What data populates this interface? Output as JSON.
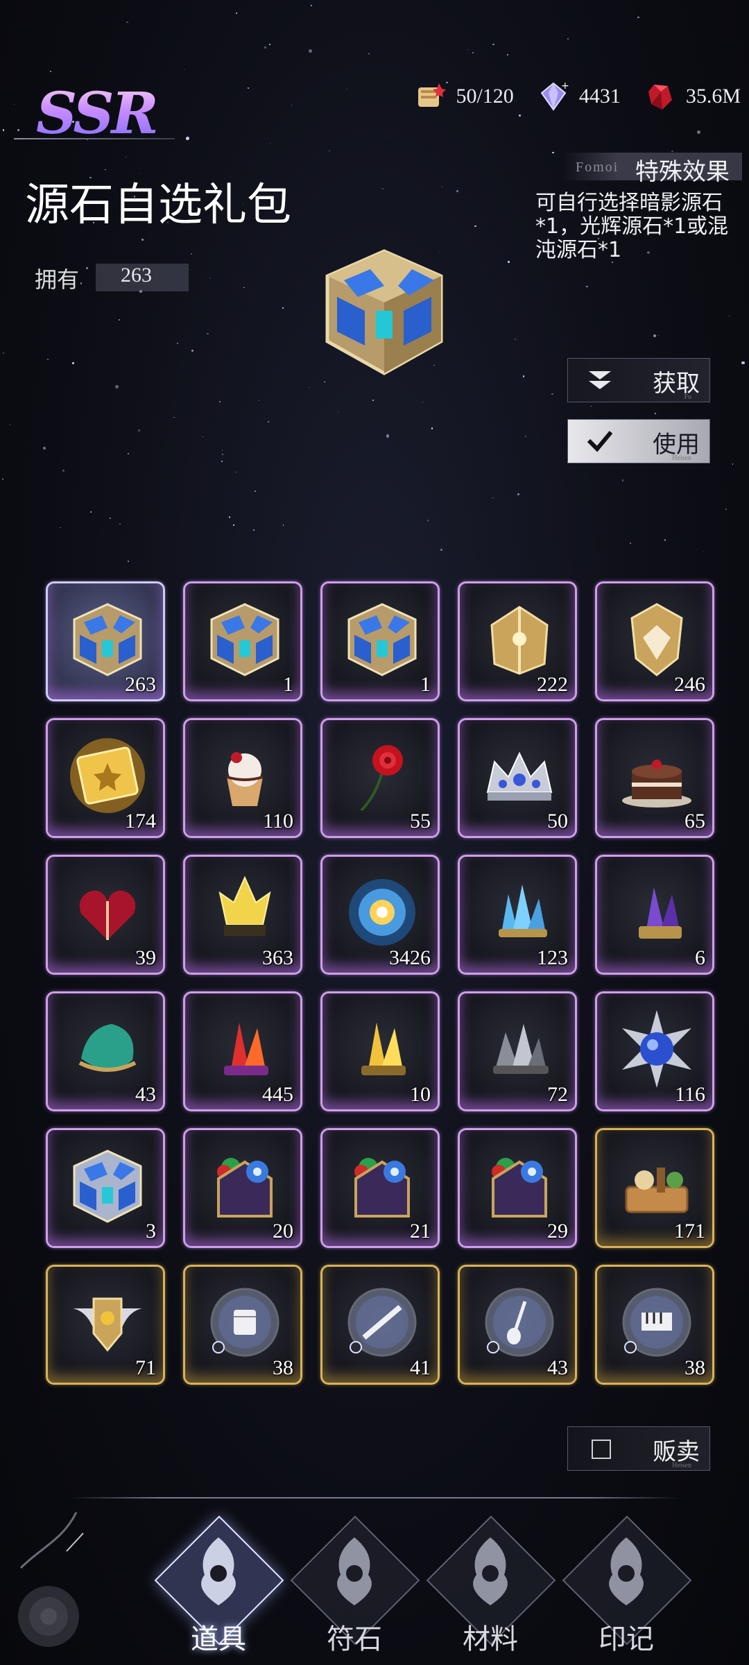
{
  "resources": [
    {
      "icon": "stamina-scroll-icon",
      "value": "50/120"
    },
    {
      "icon": "crystal-plus-icon",
      "value": "4431"
    },
    {
      "icon": "red-gem-icon",
      "value": "35.6M"
    }
  ],
  "rarity": "SSR",
  "item": {
    "name": "源石自选礼包",
    "owned_label": "拥有",
    "owned_value": "263"
  },
  "effect": {
    "subtitle": "Fomoi",
    "title": "特殊效果",
    "description": "可自行选择暗影源石*1，光辉源石*1或混沌源石*1"
  },
  "buttons": {
    "get": "获取",
    "get_sub": "Fo",
    "use": "使用",
    "use_sub": "Heisen",
    "sell": "贩卖",
    "sell_sub": "Heisen"
  },
  "inventory": [
    {
      "icon": "blue-chest-icon",
      "count": "263",
      "rarity": "ssr",
      "selected": true
    },
    {
      "icon": "blue-chest-icon",
      "count": "1",
      "rarity": "ssr"
    },
    {
      "icon": "blue-chest-icon",
      "count": "1",
      "rarity": "ssr"
    },
    {
      "icon": "gold-armor-icon",
      "count": "222",
      "rarity": "ssr"
    },
    {
      "icon": "gold-crest-icon",
      "count": "246",
      "rarity": "ssr"
    },
    {
      "icon": "gold-ticket-icon",
      "count": "174",
      "rarity": "ssr"
    },
    {
      "icon": "cupcake-icon",
      "count": "110",
      "rarity": "ssr"
    },
    {
      "icon": "red-rose-icon",
      "count": "55",
      "rarity": "ssr"
    },
    {
      "icon": "crown-icon",
      "count": "50",
      "rarity": "ssr"
    },
    {
      "icon": "chocolate-cake-icon",
      "count": "65",
      "rarity": "ssr"
    },
    {
      "icon": "gift-heart-icon",
      "count": "39",
      "rarity": "ssr"
    },
    {
      "icon": "yellow-crystal-crown-icon",
      "count": "363",
      "rarity": "ssr"
    },
    {
      "icon": "glowing-orb-icon",
      "count": "3426",
      "rarity": "ssr"
    },
    {
      "icon": "blue-crystal-icon",
      "count": "123",
      "rarity": "ssr"
    },
    {
      "icon": "purple-crystal-icon",
      "count": "6",
      "rarity": "ssr"
    },
    {
      "icon": "green-ore-icon",
      "count": "43",
      "rarity": "ssr"
    },
    {
      "icon": "red-crystal-icon",
      "count": "445",
      "rarity": "ssr"
    },
    {
      "icon": "gold-crystal-icon",
      "count": "10",
      "rarity": "ssr"
    },
    {
      "icon": "silver-ore-icon",
      "count": "72",
      "rarity": "ssr"
    },
    {
      "icon": "blue-spike-orb-icon",
      "count": "116",
      "rarity": "ssr"
    },
    {
      "icon": "silver-chest-icon",
      "count": "3",
      "rarity": "ssr"
    },
    {
      "icon": "shrine-box-icon",
      "count": "20",
      "rarity": "ssr"
    },
    {
      "icon": "shrine-box-icon",
      "count": "21",
      "rarity": "ssr"
    },
    {
      "icon": "shrine-box-icon",
      "count": "29",
      "rarity": "ssr"
    },
    {
      "icon": "food-basket-icon",
      "count": "171",
      "rarity": "ur"
    },
    {
      "icon": "winged-shield-icon",
      "count": "71",
      "rarity": "ur"
    },
    {
      "icon": "drum-orb-icon",
      "count": "38",
      "rarity": "ur"
    },
    {
      "icon": "flute-orb-icon",
      "count": "41",
      "rarity": "ur"
    },
    {
      "icon": "guitar-orb-icon",
      "count": "43",
      "rarity": "ur"
    },
    {
      "icon": "piano-orb-icon",
      "count": "38",
      "rarity": "ur"
    }
  ],
  "tabs": [
    {
      "label": "道具",
      "icon": "item-tab-icon",
      "active": true
    },
    {
      "label": "符石",
      "icon": "rune-tab-icon",
      "active": false
    },
    {
      "label": "材料",
      "icon": "material-tab-icon",
      "active": false
    },
    {
      "label": "印记",
      "icon": "mark-tab-icon",
      "active": false
    }
  ],
  "colors": {
    "ssr_frame": "#cf9ee8",
    "ur_frame": "#d8b25a",
    "background": "#0d0e16"
  }
}
